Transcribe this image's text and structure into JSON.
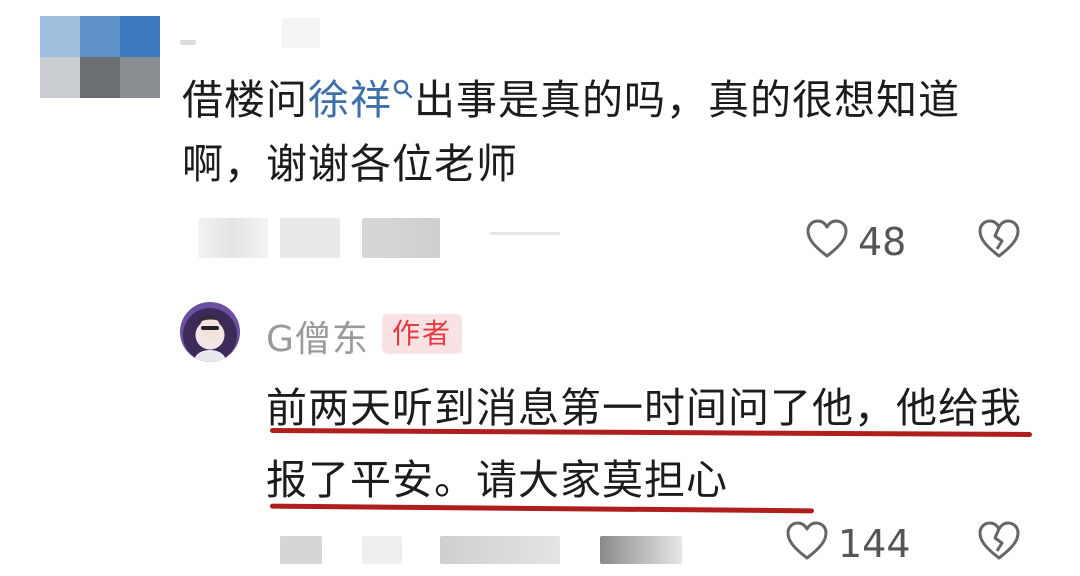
{
  "comment": {
    "text_before": "借楼问",
    "mention": "徐祥",
    "text_after": "出事是真的吗，真的很想知道啊，谢谢各位老师",
    "likes": "48"
  },
  "reply": {
    "name": "G僧东",
    "badge": "作者",
    "text": "前两天听到消息第一时间问了他，他给我报了平安。请大家莫担心",
    "likes": "144"
  },
  "colors": {
    "mention": "#3f6fa9",
    "badge_bg": "#f9e2e3",
    "badge_text": "#e33b42",
    "underline": "#b01e1e"
  },
  "icons": [
    "search-icon",
    "heart-icon",
    "broken-heart-icon",
    "avatar"
  ]
}
